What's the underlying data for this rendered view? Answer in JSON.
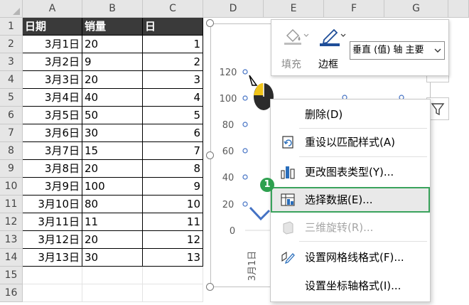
{
  "columns": [
    "A",
    "B",
    "C",
    "D",
    "E",
    "F",
    "G"
  ],
  "rows": [
    "1",
    "2",
    "3",
    "4",
    "5",
    "6",
    "7",
    "8",
    "9",
    "10",
    "11",
    "12",
    "13",
    "14",
    "15",
    "16"
  ],
  "table": {
    "headers": [
      "日期",
      "销量",
      "日"
    ],
    "data": [
      [
        "3月1日",
        "20",
        "1"
      ],
      [
        "3月2日",
        "9",
        "2"
      ],
      [
        "3月3日",
        "20",
        "3"
      ],
      [
        "3月4日",
        "40",
        "4"
      ],
      [
        "3月5日",
        "50",
        "5"
      ],
      [
        "3月6日",
        "30",
        "6"
      ],
      [
        "3月7日",
        "15",
        "7"
      ],
      [
        "3月8日",
        "20",
        "8"
      ],
      [
        "3月9日",
        "100",
        "9"
      ],
      [
        "3月10日",
        "80",
        "10"
      ],
      [
        "3月11日",
        "11",
        "11"
      ],
      [
        "3月12日",
        "20",
        "12"
      ],
      [
        "3月13日",
        "30",
        "13"
      ]
    ]
  },
  "chart": {
    "y_ticks": [
      "120",
      "100",
      "80",
      "60",
      "40",
      "20",
      "0"
    ],
    "x_label_first": "3月1日"
  },
  "toolbar": {
    "fill_label": "填充",
    "border_label": "边框",
    "selector_value": "垂直 (值) 轴 主要"
  },
  "menu": {
    "items": [
      {
        "label": "删除(D)",
        "icon": "none",
        "disabled": false
      },
      {
        "label": "重设以匹配样式(A)",
        "icon": "reset-style-icon",
        "disabled": false
      },
      {
        "label": "更改图表类型(Y)...",
        "icon": "bar-chart-icon",
        "disabled": false
      },
      {
        "label": "选择数据(E)...",
        "icon": "select-data-icon",
        "disabled": false
      },
      {
        "label": "三维旋转(R)...",
        "icon": "3d-rotate-icon",
        "disabled": true
      },
      {
        "label": "设置网格线格式(F)...",
        "icon": "format-gridlines-icon",
        "disabled": false
      },
      {
        "label": "设置坐标轴格式(I)...",
        "icon": "none",
        "disabled": false
      }
    ]
  },
  "badge_number": "1",
  "colors": {
    "header_bg": "#3a3a3a",
    "highlight_border": "#3aa35c",
    "line_series": "#4472c4",
    "badge": "#2ea04f"
  }
}
